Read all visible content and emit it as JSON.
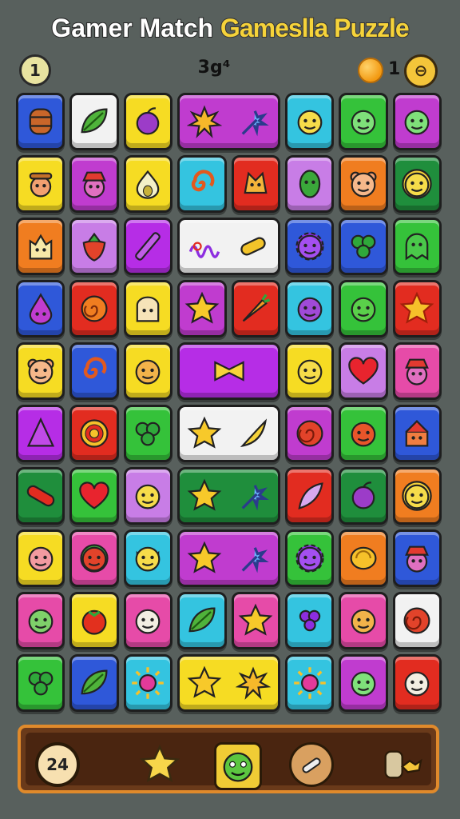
{
  "header": {
    "title_part1": "Gamer Match",
    "title_part2": "Gameslla Puzzle"
  },
  "hud": {
    "level": "1",
    "score": "3g⁴",
    "coins": "1",
    "menu_glyph": "⊖"
  },
  "colors": {
    "blue": "#2f58d9",
    "white": "#f2f2f2",
    "yellow": "#f6dc23",
    "purple": "#b62de6",
    "cyan": "#34c4e0",
    "green": "#35c23a",
    "magenta": "#c03ccf",
    "pink": "#e64ba8",
    "orange": "#f07d20",
    "red": "#e22c20",
    "dkgreen": "#1f8e3c",
    "lilac": "#c87de6",
    "violet": "#8d2ee0"
  },
  "tiles": [
    {
      "r": 0,
      "c": 0,
      "w": 1,
      "color": "blue",
      "icons": [
        "barrel-icon"
      ]
    },
    {
      "r": 0,
      "c": 1,
      "w": 1,
      "color": "white",
      "icons": [
        "leaf-icon"
      ]
    },
    {
      "r": 0,
      "c": 2,
      "w": 1,
      "color": "yellow",
      "icons": [
        "plum-icon"
      ]
    },
    {
      "r": 0,
      "c": 3,
      "w": 2,
      "color": "magenta",
      "icons": [
        "burst-icon",
        "spark-icon"
      ]
    },
    {
      "r": 0,
      "c": 5,
      "w": 1,
      "color": "cyan",
      "icons": [
        "smile-face-icon"
      ]
    },
    {
      "r": 0,
      "c": 6,
      "w": 1,
      "color": "green",
      "icons": [
        "blob-face-icon"
      ]
    },
    {
      "r": 0,
      "c": 7,
      "w": 1,
      "color": "magenta",
      "icons": [
        "blob-face-icon"
      ]
    },
    {
      "r": 1,
      "c": 0,
      "w": 1,
      "color": "yellow",
      "icons": [
        "farmer-face-icon"
      ]
    },
    {
      "r": 1,
      "c": 1,
      "w": 1,
      "color": "magenta",
      "icons": [
        "hat-face-icon"
      ]
    },
    {
      "r": 1,
      "c": 2,
      "w": 1,
      "color": "yellow",
      "icons": [
        "pear-icon"
      ]
    },
    {
      "r": 1,
      "c": 3,
      "w": 1,
      "color": "cyan",
      "icons": [
        "swirl-icon"
      ]
    },
    {
      "r": 1,
      "c": 4,
      "w": 1,
      "color": "red",
      "icons": [
        "cat-face-icon"
      ]
    },
    {
      "r": 1,
      "c": 5,
      "w": 1,
      "color": "lilac",
      "icons": [
        "pickle-face-icon"
      ]
    },
    {
      "r": 1,
      "c": 6,
      "w": 1,
      "color": "orange",
      "icons": [
        "bear-face-icon"
      ]
    },
    {
      "r": 1,
      "c": 7,
      "w": 1,
      "color": "dkgreen",
      "icons": [
        "flower-face-icon"
      ]
    },
    {
      "r": 2,
      "c": 0,
      "w": 1,
      "color": "orange",
      "icons": [
        "castle-face-icon"
      ]
    },
    {
      "r": 2,
      "c": 1,
      "w": 1,
      "color": "lilac",
      "icons": [
        "strawberry-icon"
      ]
    },
    {
      "r": 2,
      "c": 2,
      "w": 1,
      "color": "purple",
      "icons": [
        "pen-icon"
      ]
    },
    {
      "r": 2,
      "c": 3,
      "w": 2,
      "color": "white",
      "icons": [
        "scribble-icon",
        "corn-icon"
      ]
    },
    {
      "r": 2,
      "c": 5,
      "w": 1,
      "color": "blue",
      "icons": [
        "gear-face-icon"
      ]
    },
    {
      "r": 2,
      "c": 6,
      "w": 1,
      "color": "blue",
      "icons": [
        "clover-icon"
      ]
    },
    {
      "r": 2,
      "c": 7,
      "w": 1,
      "color": "green",
      "icons": [
        "ghost-face-icon"
      ]
    },
    {
      "r": 3,
      "c": 0,
      "w": 1,
      "color": "blue",
      "icons": [
        "drop-face-icon"
      ]
    },
    {
      "r": 3,
      "c": 1,
      "w": 1,
      "color": "red",
      "icons": [
        "spiral-icon"
      ]
    },
    {
      "r": 3,
      "c": 2,
      "w": 1,
      "color": "yellow",
      "icons": [
        "toast-face-icon"
      ]
    },
    {
      "r": 3,
      "c": 3,
      "w": 1,
      "color": "magenta",
      "icons": [
        "star-icon"
      ]
    },
    {
      "r": 3,
      "c": 4,
      "w": 1,
      "color": "red",
      "icons": [
        "carrot-icon"
      ]
    },
    {
      "r": 3,
      "c": 5,
      "w": 1,
      "color": "cyan",
      "icons": [
        "plum-face-icon"
      ]
    },
    {
      "r": 3,
      "c": 6,
      "w": 1,
      "color": "green",
      "icons": [
        "apple-face-icon"
      ]
    },
    {
      "r": 3,
      "c": 7,
      "w": 1,
      "color": "red",
      "icons": [
        "puzzle-star-icon"
      ]
    },
    {
      "r": 4,
      "c": 0,
      "w": 1,
      "color": "yellow",
      "icons": [
        "bear-face-icon"
      ]
    },
    {
      "r": 4,
      "c": 1,
      "w": 1,
      "color": "blue",
      "icons": [
        "swirl-icon"
      ]
    },
    {
      "r": 4,
      "c": 2,
      "w": 1,
      "color": "yellow",
      "icons": [
        "peach-face-icon"
      ]
    },
    {
      "r": 4,
      "c": 3,
      "w": 2,
      "color": "purple",
      "icons": [
        "bow-icon"
      ]
    },
    {
      "r": 4,
      "c": 5,
      "w": 1,
      "color": "yellow",
      "icons": [
        "smile-face-icon"
      ]
    },
    {
      "r": 4,
      "c": 6,
      "w": 1,
      "color": "lilac",
      "icons": [
        "heart-icon"
      ]
    },
    {
      "r": 4,
      "c": 7,
      "w": 1,
      "color": "pink",
      "icons": [
        "hat-face-icon"
      ]
    },
    {
      "r": 5,
      "c": 0,
      "w": 1,
      "color": "purple",
      "icons": [
        "triangle-icon"
      ]
    },
    {
      "r": 5,
      "c": 1,
      "w": 1,
      "color": "red",
      "icons": [
        "target-icon"
      ]
    },
    {
      "r": 5,
      "c": 2,
      "w": 1,
      "color": "green",
      "icons": [
        "clover-icon"
      ]
    },
    {
      "r": 5,
      "c": 3,
      "w": 2,
      "color": "white",
      "icons": [
        "star-icon",
        "banana-icon"
      ]
    },
    {
      "r": 5,
      "c": 5,
      "w": 1,
      "color": "magenta",
      "icons": [
        "rose-icon"
      ]
    },
    {
      "r": 5,
      "c": 6,
      "w": 1,
      "color": "green",
      "icons": [
        "bug-face-icon"
      ]
    },
    {
      "r": 5,
      "c": 7,
      "w": 1,
      "color": "blue",
      "icons": [
        "cake-face-icon"
      ]
    },
    {
      "r": 6,
      "c": 0,
      "w": 1,
      "color": "dkgreen",
      "icons": [
        "pepper-icon"
      ]
    },
    {
      "r": 6,
      "c": 1,
      "w": 1,
      "color": "green",
      "icons": [
        "heart-icon"
      ]
    },
    {
      "r": 6,
      "c": 2,
      "w": 1,
      "color": "lilac",
      "icons": [
        "onion-face-icon"
      ]
    },
    {
      "r": 6,
      "c": 3,
      "w": 2,
      "color": "dkgreen",
      "icons": [
        "star-icon",
        "spark-icon"
      ]
    },
    {
      "r": 6,
      "c": 5,
      "w": 1,
      "color": "red",
      "icons": [
        "feather-icon"
      ]
    },
    {
      "r": 6,
      "c": 6,
      "w": 1,
      "color": "dkgreen",
      "icons": [
        "plum-icon"
      ]
    },
    {
      "r": 6,
      "c": 7,
      "w": 1,
      "color": "orange",
      "icons": [
        "flower-face-icon"
      ]
    },
    {
      "r": 7,
      "c": 0,
      "w": 1,
      "color": "yellow",
      "icons": [
        "pig-face-icon"
      ]
    },
    {
      "r": 7,
      "c": 1,
      "w": 1,
      "color": "pink",
      "icons": [
        "melon-face-icon"
      ]
    },
    {
      "r": 7,
      "c": 2,
      "w": 1,
      "color": "cyan",
      "icons": [
        "crown-face-icon"
      ]
    },
    {
      "r": 7,
      "c": 3,
      "w": 2,
      "color": "magenta",
      "icons": [
        "star-icon",
        "spark-icon"
      ]
    },
    {
      "r": 7,
      "c": 5,
      "w": 1,
      "color": "green",
      "icons": [
        "gear-face-icon"
      ]
    },
    {
      "r": 7,
      "c": 6,
      "w": 1,
      "color": "orange",
      "icons": [
        "lemon-icon"
      ]
    },
    {
      "r": 7,
      "c": 7,
      "w": 1,
      "color": "blue",
      "icons": [
        "hat-face-icon"
      ]
    },
    {
      "r": 8,
      "c": 0,
      "w": 1,
      "color": "pink",
      "icons": [
        "frog-face-icon"
      ]
    },
    {
      "r": 8,
      "c": 1,
      "w": 1,
      "color": "yellow",
      "icons": [
        "tomato-icon"
      ]
    },
    {
      "r": 8,
      "c": 2,
      "w": 1,
      "color": "pink",
      "icons": [
        "cow-face-icon"
      ]
    },
    {
      "r": 8,
      "c": 3,
      "w": 1,
      "color": "cyan",
      "icons": [
        "leaf-icon"
      ]
    },
    {
      "r": 8,
      "c": 4,
      "w": 1,
      "color": "pink",
      "icons": [
        "star-icon"
      ]
    },
    {
      "r": 8,
      "c": 5,
      "w": 1,
      "color": "cyan",
      "icons": [
        "grape-icon"
      ]
    },
    {
      "r": 8,
      "c": 6,
      "w": 1,
      "color": "pink",
      "icons": [
        "peach-face-icon"
      ]
    },
    {
      "r": 8,
      "c": 7,
      "w": 1,
      "color": "white",
      "icons": [
        "rose-icon"
      ]
    },
    {
      "r": 9,
      "c": 0,
      "w": 1,
      "color": "green",
      "icons": [
        "clover-icon"
      ]
    },
    {
      "r": 9,
      "c": 1,
      "w": 1,
      "color": "blue",
      "icons": [
        "leaf-icon"
      ]
    },
    {
      "r": 9,
      "c": 2,
      "w": 1,
      "color": "cyan",
      "icons": [
        "sun-icon"
      ]
    },
    {
      "r": 9,
      "c": 3,
      "w": 2,
      "color": "yellow",
      "icons": [
        "star-icon",
        "burst-icon"
      ]
    },
    {
      "r": 9,
      "c": 5,
      "w": 1,
      "color": "cyan",
      "icons": [
        "sun-icon"
      ]
    },
    {
      "r": 9,
      "c": 6,
      "w": 1,
      "color": "magenta",
      "icons": [
        "blob-face-icon"
      ]
    },
    {
      "r": 9,
      "c": 7,
      "w": 1,
      "color": "red",
      "icons": [
        "cow-face-icon"
      ]
    }
  ],
  "toolbar": {
    "moves": "24"
  }
}
